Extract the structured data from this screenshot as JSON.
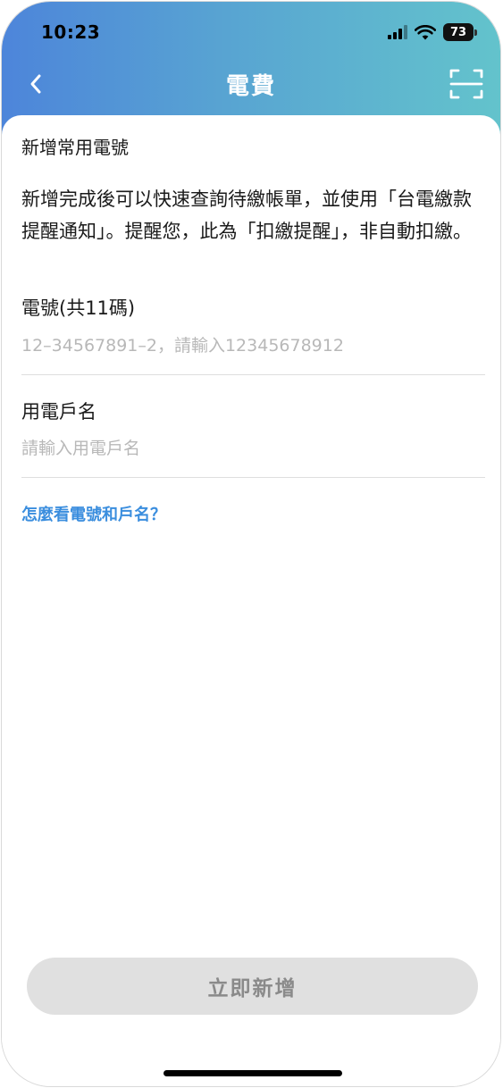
{
  "status_bar": {
    "time": "10:23",
    "battery": "73",
    "icons": [
      "signal-icon",
      "wifi-icon",
      "battery-icon"
    ]
  },
  "nav": {
    "title": "電費",
    "back_icon": "chevron-left-icon",
    "scan_icon": "scan-icon"
  },
  "form": {
    "section_title": "新增常用電號",
    "description": "新增完成後可以快速查詢待繳帳單，並使用「台電繳款提醒通知」。提醒您，此為「扣繳提醒」，非自動扣繳。",
    "meter_number": {
      "label": "電號(共11碼)",
      "value": "",
      "placeholder": "12–34567891–2，請輸入12345678912"
    },
    "account_name": {
      "label": "用電戶名",
      "value": "",
      "placeholder": "請輸入用電戶名"
    },
    "help_link": "怎麼看電號和戶名？",
    "submit_label": "立即新增"
  },
  "colors": {
    "header_gradient_start": "#4d85da",
    "header_gradient_end": "#63c3cc",
    "link": "#3b8ede",
    "button_disabled_bg": "#e0e0e0",
    "button_disabled_text": "#8a8a8a"
  }
}
